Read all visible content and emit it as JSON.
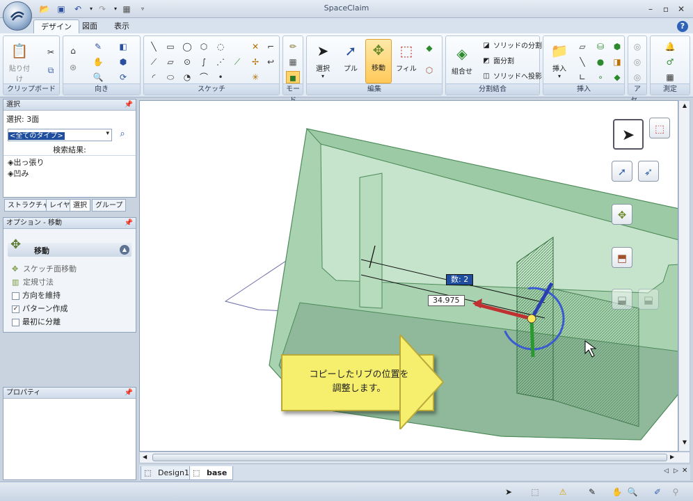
{
  "app": {
    "title": "SpaceClaim"
  },
  "ribbon_tabs": [
    "デザイン",
    "図面",
    "表示"
  ],
  "ribbon": {
    "clipboard": {
      "label": "クリップボード",
      "paste": "貼り付け"
    },
    "orient": {
      "label": "向き"
    },
    "sketch": {
      "label": "スケッチ"
    },
    "mode": {
      "label": "モード"
    },
    "edit": {
      "label": "編集",
      "select": "選択",
      "pull": "プル",
      "move": "移動",
      "fill": "フィル"
    },
    "intersect": {
      "label": "分割結合",
      "combine": "組合せ",
      "split_body": "ソリッドの分割",
      "split_face": "面分割",
      "project": "ソリッドへ投影"
    },
    "insert": {
      "label": "挿入",
      "insert": "挿入"
    },
    "assembly": {
      "label": "アセ..."
    },
    "measure": {
      "label": "測定"
    }
  },
  "select_panel": {
    "title": "選択",
    "selection": "選択: 3面",
    "type_filter": "<全てのタイプ>",
    "results_label": "検索結果:",
    "results": [
      "出っ張り",
      "凹み"
    ]
  },
  "left_tabs": [
    "ストラクチャー",
    "レイヤ",
    "選択",
    "グループ"
  ],
  "options_panel": {
    "title": "オプション - 移動",
    "header": "移動",
    "items": [
      {
        "label": "スケッチ面移動",
        "checkbox": false,
        "checked": false
      },
      {
        "label": "定規寸法",
        "checkbox": false,
        "checked": false
      },
      {
        "label": "方向を維持",
        "checkbox": true,
        "checked": false
      },
      {
        "label": "パターン作成",
        "checkbox": true,
        "checked": true
      },
      {
        "label": "最初に分離",
        "checkbox": true,
        "checked": false
      }
    ]
  },
  "properties_panel": {
    "title": "プロパティ"
  },
  "viewport": {
    "dimension_count": "数: 2",
    "dimension_value": "34.975",
    "callout": [
      "コピーしたリブの位置を",
      "調整します。"
    ]
  },
  "doc_tabs": [
    "Design1",
    "base"
  ],
  "colors": {
    "model_green": "#8fc09a",
    "callout_yellow": "#f6ef6e",
    "accent_orange": "#ffc95a"
  }
}
